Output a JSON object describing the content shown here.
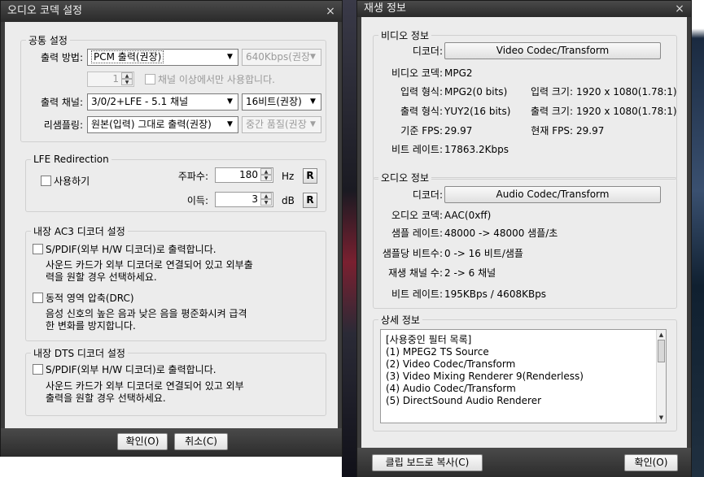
{
  "audio_dialog": {
    "title": "오디오 코덱 설정",
    "close": "×",
    "common": {
      "legend": "공통 설정",
      "output_method_label": "출력 방법:",
      "output_method_value": "PCM 출력(권장)",
      "bitrate_value": "640Kbps(권장",
      "channel_spin_value": "1",
      "channel_above_only": "채널 이상에서만 사용합니다.",
      "output_channel_label": "출력 채널:",
      "output_channel_value": "3/0/2+LFE - 5.1 채널",
      "bit_value": "16비트(권장)",
      "resampling_label": "리샘플링:",
      "resampling_value": "원본(입력) 그대로 출력(권장)",
      "quality_value": "중간 품질(권장"
    },
    "lfe": {
      "legend": "LFE Redirection",
      "use_label": "사용하기",
      "freq_label": "주파수:",
      "freq_value": "180",
      "freq_unit": "Hz",
      "gain_label": "이득:",
      "gain_value": "3",
      "gain_unit": "dB",
      "reset_label": "R"
    },
    "ac3": {
      "legend": "내장 AC3 디코더 설정",
      "spdif_label": "S/PDIF(외부 H/W 디코더)로 출력합니다.",
      "spdif_desc_1": "사운드 카드가 외부 디코더로 연결되어 있고 외부출",
      "spdif_desc_2": "력을 원할 경우 선택하세요.",
      "drc_label": "동적 영역 압축(DRC)",
      "drc_desc_1": "음성 신호의 높은 음과 낮은 음을 평준화시켜 급격",
      "drc_desc_2": "한 변화를 방지합니다."
    },
    "dts": {
      "legend": "내장 DTS 디코더 설정",
      "spdif_label": "S/PDIF(외부 H/W 디코더)로 출력합니다.",
      "spdif_desc_1": "사운드 카드가 외부 디코더로 연결되어 있고 외부",
      "spdif_desc_2": "출력을 원할 경우 선택하세요."
    },
    "ok_label": "확인(O)",
    "cancel_label": "취소(C)"
  },
  "playback_dialog": {
    "title": "재생 정보",
    "close": "×",
    "video": {
      "legend": "비디오 정보",
      "decoder_label": "디코더:",
      "decoder_value": "Video Codec/Transform",
      "codec_label": "비디오 코덱:",
      "codec_value": "MPG2",
      "input_format_label": "입력 형식:",
      "input_format_value": "MPG2(0 bits)",
      "input_size_label": "입력 크기:",
      "input_size_value": "1920 x 1080(1.78:1)",
      "output_format_label": "출력 형식:",
      "output_format_value": "YUY2(16 bits)",
      "output_size_label": "출력 크기:",
      "output_size_value": "1920 x 1080(1.78:1)",
      "base_fps_label": "기준 FPS:",
      "base_fps_value": "29.97",
      "cur_fps_label": "현재 FPS:",
      "cur_fps_value": "29.97",
      "bitrate_label": "비트 레이트:",
      "bitrate_value": "17863.2Kbps"
    },
    "audio": {
      "legend": "오디오 정보",
      "decoder_label": "디코더:",
      "decoder_value": "Audio Codec/Transform",
      "codec_label": "오디오 코덱:",
      "codec_value": "AAC(0xff)",
      "sample_rate_label": "샘플 레이트:",
      "sample_rate_value": "48000 -> 48000 샘플/초",
      "bits_label": "샘플당 비트수:",
      "bits_value": "0 -> 16 비트/샘플",
      "channels_label": "재생 채널 수:",
      "channels_value": "2 -> 6 채널",
      "bitrate_label": "비트 레이트:",
      "bitrate_value": "195KBps / 4608KBps"
    },
    "detail": {
      "legend": "상세 정보",
      "lines": [
        "[사용중인 필터 목록]",
        "(1) MPEG2 TS Source",
        "(2) Video Codec/Transform",
        "(3) Video Mixing Renderer 9(Renderless)",
        "(4) Audio Codec/Transform",
        "(5) DirectSound Audio Renderer"
      ]
    },
    "clipboard_label": "클립 보드로 복사(C)",
    "ok_label": "확인(O)"
  }
}
